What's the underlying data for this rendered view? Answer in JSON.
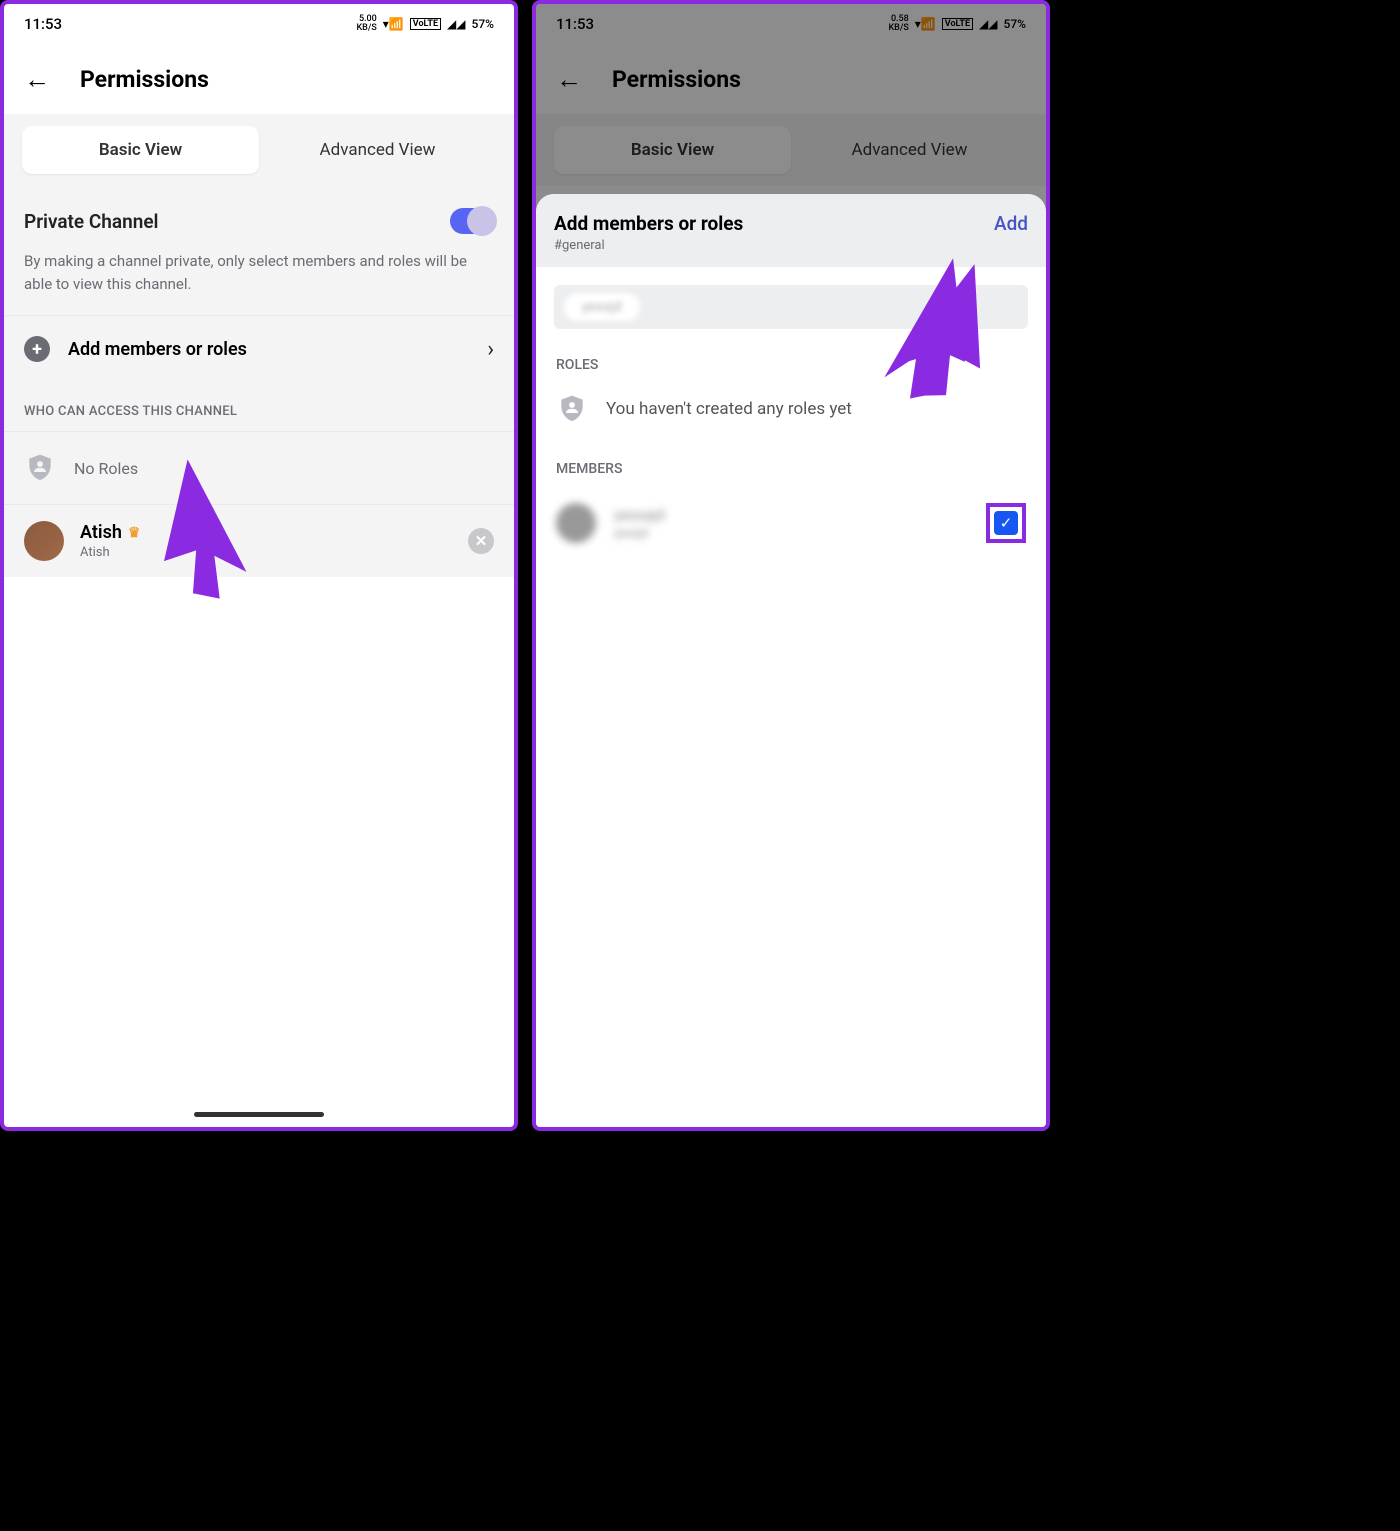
{
  "status": {
    "time": "11:53",
    "speed1": "5.00",
    "speed2": "0.58",
    "speed_unit": "KB/S",
    "battery": "57%"
  },
  "header": {
    "title": "Permissions"
  },
  "tabs": {
    "basic": "Basic View",
    "advanced": "Advanced View"
  },
  "left": {
    "private_title": "Private Channel",
    "private_desc": "By making a channel private, only select members and roles will be able to view this channel.",
    "add_label": "Add members or roles",
    "who_header": "WHO CAN ACCESS THIS CHANNEL",
    "no_roles": "No Roles",
    "member_name": "Atish",
    "member_sub": "Atish"
  },
  "right": {
    "sheet_title": "Add members or roles",
    "sheet_sub": "#general",
    "add_btn": "Add",
    "roles_header": "ROLES",
    "roles_empty": "You haven't created any roles yet",
    "members_header": "MEMBERS",
    "blur_name": "yessajd",
    "blur_sub": "yessjd"
  }
}
